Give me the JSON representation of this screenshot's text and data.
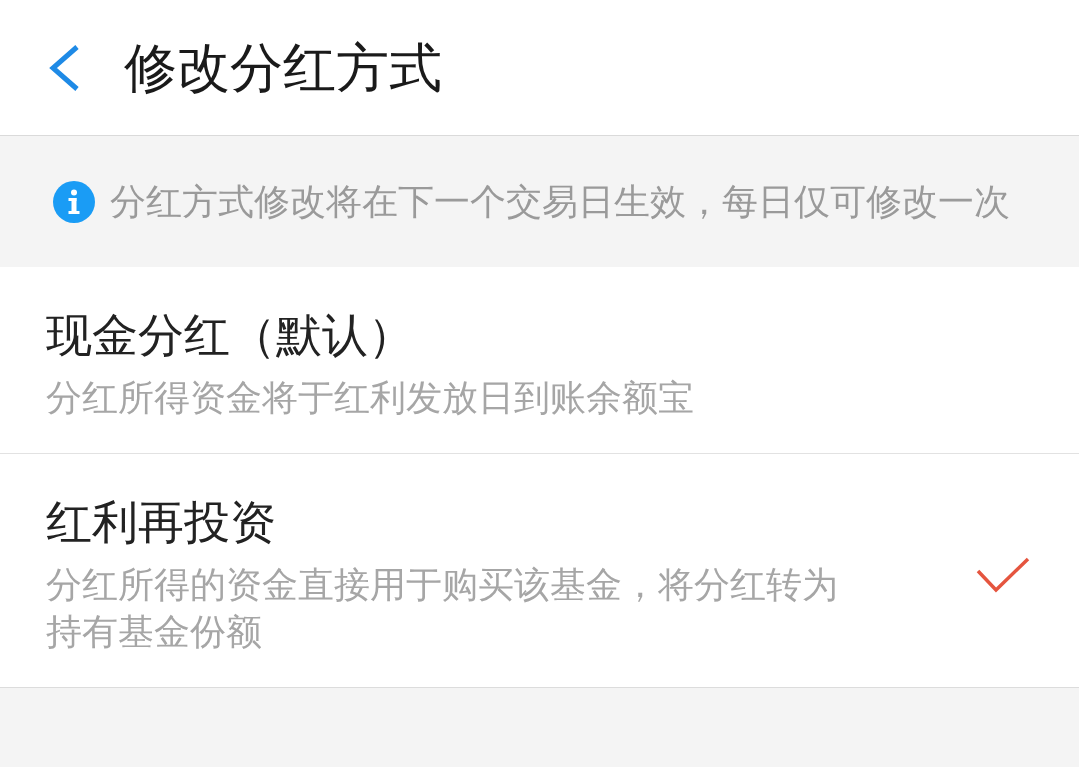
{
  "header": {
    "title": "修改分红方式"
  },
  "notice": {
    "text": "分红方式修改将在下一个交易日生效，每日仅可修改一次"
  },
  "options": [
    {
      "title": "现金分红（默认）",
      "description": "分红所得资金将于红利发放日到账余额宝",
      "selected": false
    },
    {
      "title": "红利再投资",
      "description": "分红所得的资金直接用于购买该基金，将分红转为持有基金份额",
      "selected": true
    }
  ]
}
